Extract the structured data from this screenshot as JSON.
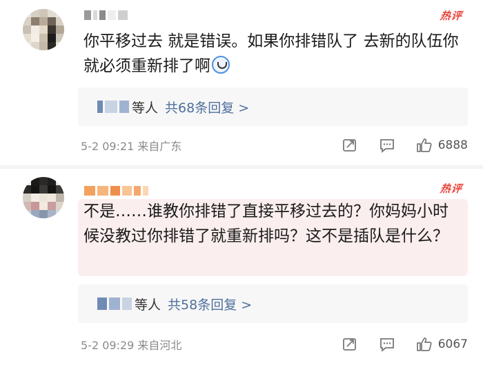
{
  "comments": [
    {
      "text": "你平移过去 就是错误。如果你排错队了 去新的队伍你就必须重新排了啊",
      "hot_badge": "热评",
      "reply_label": "等人",
      "reply_count": "共68条回复 >",
      "meta": "5-2 09:21 来自广东",
      "likes": "6888"
    },
    {
      "text": "不是……谁教你排错了直接平移过去的？你妈妈小时候没教过你排错了就重新排吗？这不是插队是什么？",
      "hot_badge": "热评",
      "reply_label": "等人",
      "reply_count": "共58条回复 >",
      "meta": "5-2 09:29 来自河北",
      "likes": "6067"
    }
  ],
  "colors": {
    "hot_badge": "#e8453c",
    "reply_link": "#4e6f9c",
    "highlight_bg": "#fbeeee"
  },
  "icons": [
    "share-icon",
    "comment-icon",
    "like-icon",
    "emoji-icon"
  ]
}
